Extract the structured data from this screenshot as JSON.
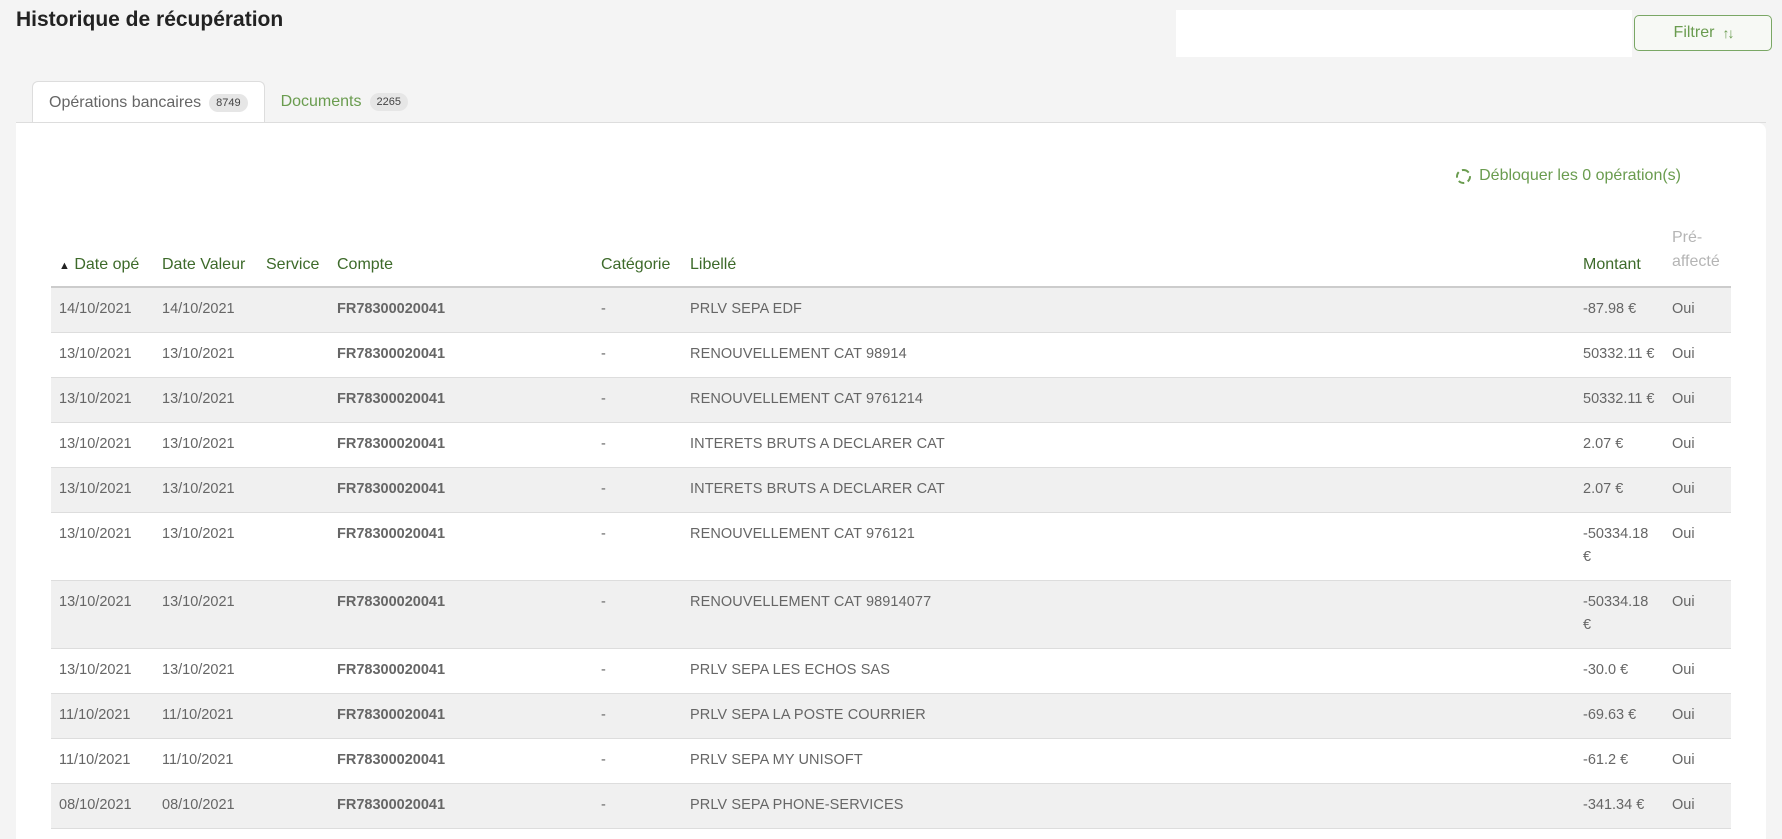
{
  "page": {
    "title": "Historique de récupération"
  },
  "filter": {
    "label": "Filtrer",
    "icon": "sort-icon"
  },
  "tabs": [
    {
      "label": "Opérations bancaires",
      "count": "8749",
      "active": true
    },
    {
      "label": "Documents",
      "count": "2265",
      "active": false
    }
  ],
  "unlock": {
    "label": "Débloquer les 0 opération(s)",
    "icon": "refresh-icon"
  },
  "table": {
    "headers": {
      "date_ope": "Date opé",
      "date_valeur": "Date Valeur",
      "service": "Service",
      "compte": "Compte",
      "categorie": "Catégorie",
      "libelle": "Libellé",
      "montant": "Montant",
      "pre_affecte_1": "Pré-",
      "pre_affecte_2": "affecté"
    },
    "rows": [
      {
        "date_ope": "14/10/2021",
        "date_valeur": "14/10/2021",
        "service": "",
        "compte": "FR78300020041",
        "categorie": "-",
        "libelle": "PRLV SEPA EDF",
        "montant": "-87.98 €",
        "pre_affecte": "Oui"
      },
      {
        "date_ope": "13/10/2021",
        "date_valeur": "13/10/2021",
        "service": "",
        "compte": "FR78300020041",
        "categorie": "-",
        "libelle": "RENOUVELLEMENT CAT 98914",
        "montant": "50332.11 €",
        "pre_affecte": "Oui"
      },
      {
        "date_ope": "13/10/2021",
        "date_valeur": "13/10/2021",
        "service": "",
        "compte": "FR78300020041",
        "categorie": "-",
        "libelle": "RENOUVELLEMENT CAT 9761214",
        "montant": "50332.11 €",
        "pre_affecte": "Oui"
      },
      {
        "date_ope": "13/10/2021",
        "date_valeur": "13/10/2021",
        "service": "",
        "compte": "FR78300020041",
        "categorie": "-",
        "libelle": "INTERETS BRUTS A DECLARER CAT",
        "montant": "2.07 €",
        "pre_affecte": "Oui"
      },
      {
        "date_ope": "13/10/2021",
        "date_valeur": "13/10/2021",
        "service": "",
        "compte": "FR78300020041",
        "categorie": "-",
        "libelle": "INTERETS BRUTS A DECLARER CAT",
        "montant": "2.07 €",
        "pre_affecte": "Oui"
      },
      {
        "date_ope": "13/10/2021",
        "date_valeur": "13/10/2021",
        "service": "",
        "compte": "FR78300020041",
        "categorie": "-",
        "libelle": "RENOUVELLEMENT CAT 976121",
        "montant": "-50334.18 €",
        "pre_affecte": "Oui"
      },
      {
        "date_ope": "13/10/2021",
        "date_valeur": "13/10/2021",
        "service": "",
        "compte": "FR78300020041",
        "categorie": "-",
        "libelle": "RENOUVELLEMENT CAT 98914077",
        "montant": "-50334.18 €",
        "pre_affecte": "Oui"
      },
      {
        "date_ope": "13/10/2021",
        "date_valeur": "13/10/2021",
        "service": "",
        "compte": "FR78300020041",
        "categorie": "-",
        "libelle": "PRLV SEPA LES ECHOS SAS",
        "montant": "-30.0 €",
        "pre_affecte": "Oui"
      },
      {
        "date_ope": "11/10/2021",
        "date_valeur": "11/10/2021",
        "service": "",
        "compte": "FR78300020041",
        "categorie": "-",
        "libelle": "PRLV SEPA LA POSTE COURRIER",
        "montant": "-69.63 €",
        "pre_affecte": "Oui"
      },
      {
        "date_ope": "11/10/2021",
        "date_valeur": "11/10/2021",
        "service": "",
        "compte": "FR78300020041",
        "categorie": "-",
        "libelle": "PRLV SEPA MY UNISOFT",
        "montant": "-61.2 €",
        "pre_affecte": "Oui"
      },
      {
        "date_ope": "08/10/2021",
        "date_valeur": "08/10/2021",
        "service": "",
        "compte": "FR78300020041",
        "categorie": "-",
        "libelle": "PRLV SEPA PHONE-SERVICES",
        "montant": "-341.34 €",
        "pre_affecte": "Oui"
      }
    ]
  }
}
